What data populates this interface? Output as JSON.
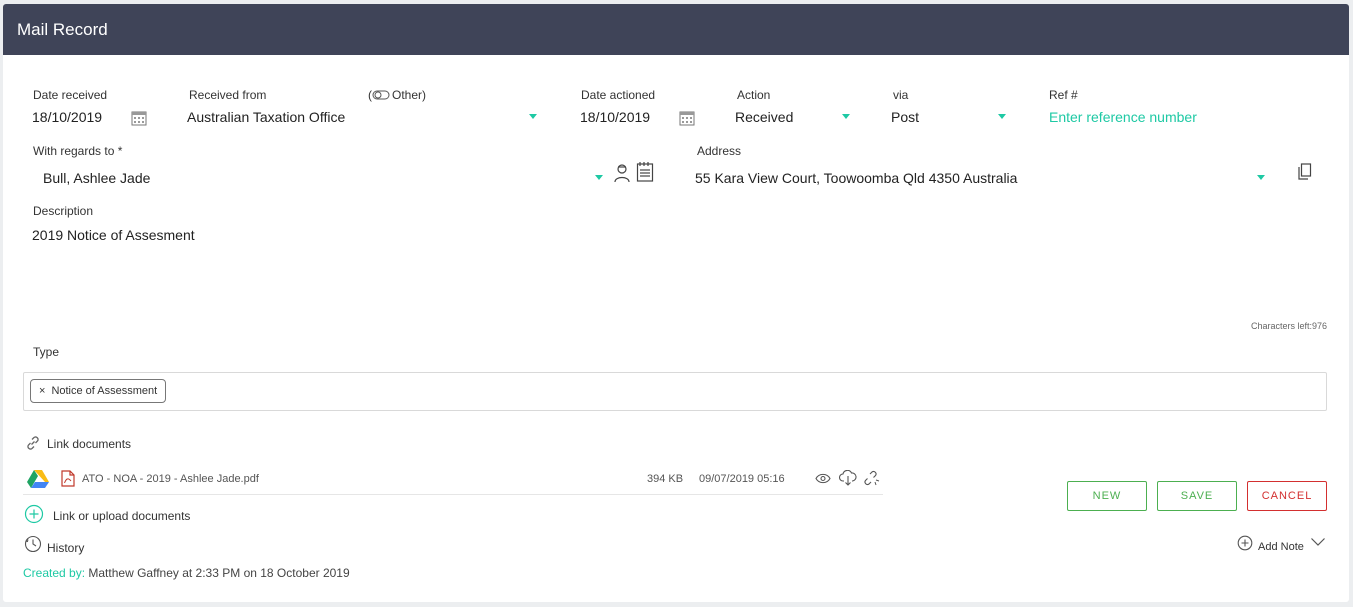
{
  "header": {
    "title": "Mail Record"
  },
  "form": {
    "date_received_label": "Date received",
    "date_received_value": "18/10/2019",
    "received_from_label": "Received from",
    "received_from_value": "Australian Taxation Office",
    "other_toggle_label": "Other)",
    "date_actioned_label": "Date actioned",
    "date_actioned_value": "18/10/2019",
    "action_label": "Action",
    "action_value": "Received",
    "via_label": "via",
    "via_value": "Post",
    "ref_label": "Ref #",
    "ref_placeholder": "Enter reference number",
    "regards_label": "With regards to *",
    "regards_value": "Bull, Ashlee Jade",
    "address_label": "Address",
    "address_value": "55 Kara View Court, Toowoomba Qld 4350 Australia",
    "description_label": "Description",
    "description_value": "2019 Notice of Assesment",
    "chars_left": "Characters left:976",
    "type_label": "Type",
    "type_chip": "Notice of Assessment",
    "type_chip_remove": "×"
  },
  "documents": {
    "link_label": "Link documents",
    "file_name": "ATO - NOA - 2019 - Ashlee Jade.pdf",
    "file_size": "394 KB",
    "file_date": "09/07/2019 05:16",
    "upload_label": "Link or upload documents"
  },
  "buttons": {
    "new": "NEW",
    "save": "SAVE",
    "cancel": "CANCEL"
  },
  "history": {
    "label": "History",
    "add_note": "Add Note",
    "created_by_label": "Created by:",
    "created_by_value": " Matthew Gaffney at 2:33 PM on 18 October 2019"
  },
  "colors": {
    "header_bg": "#3f4458",
    "accent": "#1ec9a4",
    "save_green": "#4caf50",
    "cancel_red": "#d32f2f"
  },
  "icons": [
    "calendar-icon",
    "toggle-icon",
    "caret-down-icon",
    "person-icon",
    "notepad-icon",
    "copy-icon",
    "link-icon",
    "google-drive-icon",
    "pdf-icon",
    "eye-icon",
    "cloud-download-icon",
    "unlink-icon",
    "add-circle-icon",
    "clock-icon",
    "chevron-down-icon"
  ]
}
